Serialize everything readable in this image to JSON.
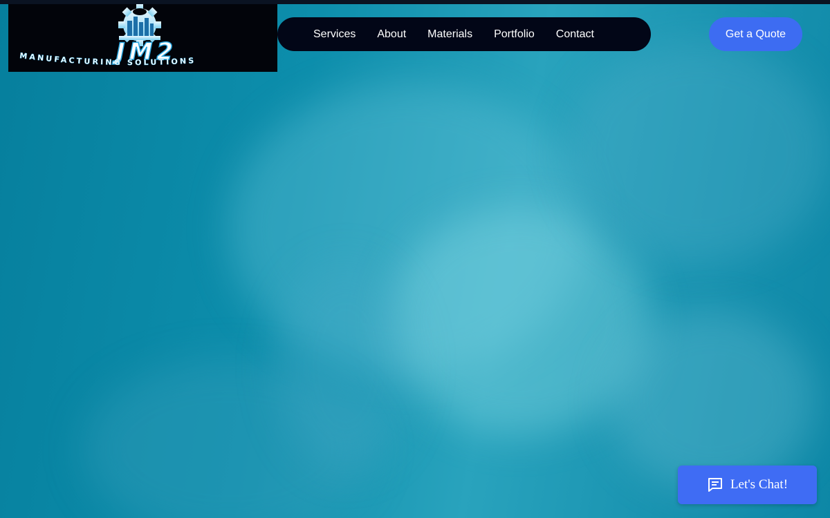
{
  "logo": {
    "brand": "JM2",
    "tagline": "MANUFACTURING SOLUTIONS"
  },
  "nav": {
    "items": [
      {
        "label": "Services"
      },
      {
        "label": "About"
      },
      {
        "label": "Materials"
      },
      {
        "label": "Portfolio"
      },
      {
        "label": "Contact"
      }
    ]
  },
  "cta": {
    "quote_label": "Get a Quote"
  },
  "chat": {
    "label": "Let's Chat!",
    "icon": "chat-icon"
  },
  "colors": {
    "nav_background": "#020617",
    "accent": "#3d6cf2",
    "hero_tint": "#0c8aa8"
  }
}
